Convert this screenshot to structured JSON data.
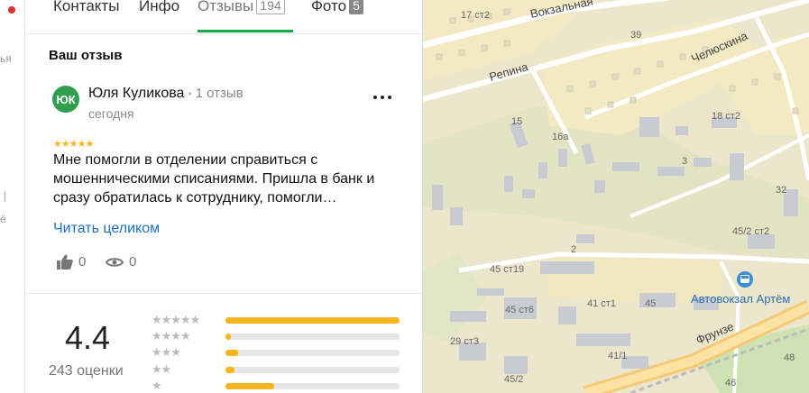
{
  "tabs": [
    {
      "label": "Контакты",
      "count": ""
    },
    {
      "label": "Инфо",
      "count": ""
    },
    {
      "label": "Отзывы",
      "count": "194"
    },
    {
      "label": "Фото",
      "count": "5"
    }
  ],
  "strip": {
    "frag1": "ья",
    "frag2": "ё"
  },
  "section_title": "Ваш отзыв",
  "review": {
    "avatar_initials": "ЮК",
    "author": "Юля Куликова",
    "author_reviews": "1 отзыв",
    "date": "сегодня",
    "stars": "★★★★★",
    "text": "Мне помогли в отделении справиться с мошенническими списаниями. Пришла в банк и сразу обратилась к сотруднику, помогли…",
    "read_more": "Читать целиком",
    "likes": "0",
    "views": "0"
  },
  "rating": {
    "value": "4.4",
    "count_label": "243 оценки",
    "rows": [
      {
        "stars": "★★★★★",
        "fraction": 1.0
      },
      {
        "stars": "★★★★",
        "fraction": 0.03
      },
      {
        "stars": "★★★",
        "fraction": 0.07
      },
      {
        "stars": "★★",
        "fraction": 0.05
      },
      {
        "stars": "★",
        "fraction": 0.28
      }
    ]
  },
  "map": {
    "streets": [
      "Вокзальная",
      "Челюскина",
      "Репина",
      "Фрунзе"
    ],
    "house_labels": [
      "17 ст2",
      "39",
      "15",
      "16а",
      "18 ст2",
      "3",
      "32",
      "2",
      "45/2 ст2",
      "45 ст19",
      "45 ст6",
      "41 ст1",
      "45",
      "29 ст3",
      "41/1",
      "45/2",
      "48",
      "46"
    ],
    "poi_name": "Автовокзал Артём",
    "poi_icon": "bus-stop-icon"
  },
  "colors": {
    "accent_green": "#1ea84a",
    "star": "#fbb51f",
    "link": "#1b72bd"
  }
}
